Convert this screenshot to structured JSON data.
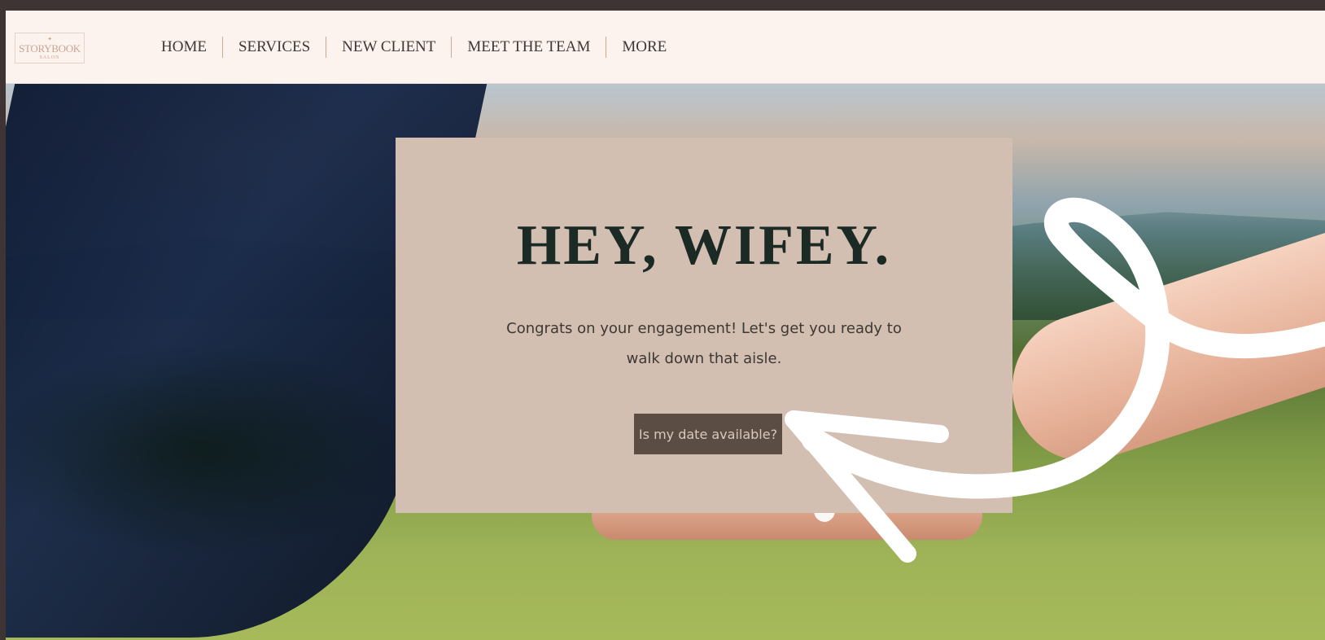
{
  "header": {
    "logo": {
      "mark": "✦",
      "text": "STORYBOOK",
      "sub": "SALON"
    },
    "nav": [
      {
        "label": "HOME"
      },
      {
        "label": "SERVICES"
      },
      {
        "label": "NEW CLIENT"
      },
      {
        "label": "MEET THE TEAM"
      },
      {
        "label": "MORE"
      }
    ]
  },
  "hero": {
    "title": "HEY, WIFEY.",
    "subtitle_line1": "Congrats on your engagement! Let's get you ready to",
    "subtitle_line2": "walk down that aisle.",
    "cta_label": "Is my date available?"
  },
  "colors": {
    "header_bg": "#fdf3ee",
    "card_bg": "#d3bfb1",
    "cta_bg": "#5c4d44",
    "title_text": "#1c2a25",
    "frame_dark": "#3e3434",
    "annotation_white": "#ffffff"
  },
  "icons": {
    "logo": "crown-logo-icon",
    "annotation": "hand-drawn-arrow-icon"
  }
}
